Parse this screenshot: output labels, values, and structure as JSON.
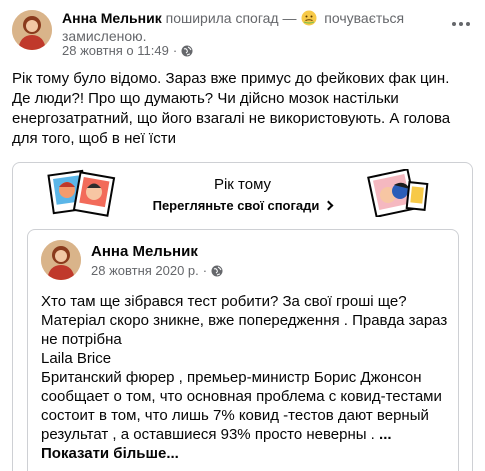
{
  "post": {
    "author": "Анна Мельник",
    "action": "поширила спогад —",
    "feeling_emoji": "sick-face-emoji",
    "feeling_text": "почувається замисленою.",
    "timestamp": "28 жовтня о 11:49",
    "dot": "·",
    "text": "Рік тому було відомо. Зараз вже примус до фейкових фак цин. Де люди?! Про що думають? Чи дійсно мозок настільки енергозатратний, що його взагалі не використовують. А голова для того, щоб в неї їсти"
  },
  "memory": {
    "title": "Рік тому",
    "link_label": "Перегляньте свої спогади"
  },
  "shared": {
    "author": "Анна Мельник",
    "timestamp": "28 жовтня 2020 р.",
    "dot": "·",
    "lines": [
      "Хто там ще зібрався тест робити? За свої гроші ще? Матеріал скоро зникне, вже попередження . Правда зараз не потрібна",
      "Laila Brice",
      "Британский фюрер , премьер-министр Борис Джонсон сообщает о том, что основная проблема с ковид-тестами состоит в том, что лишь 7% ковид -тестов дают верный результат , а оставшиеся 93% просто неверны ."
    ],
    "see_more": "... Показати більше..."
  },
  "colors": {
    "text": "#050505",
    "secondary": "#65676b",
    "border": "#ced0d4"
  }
}
